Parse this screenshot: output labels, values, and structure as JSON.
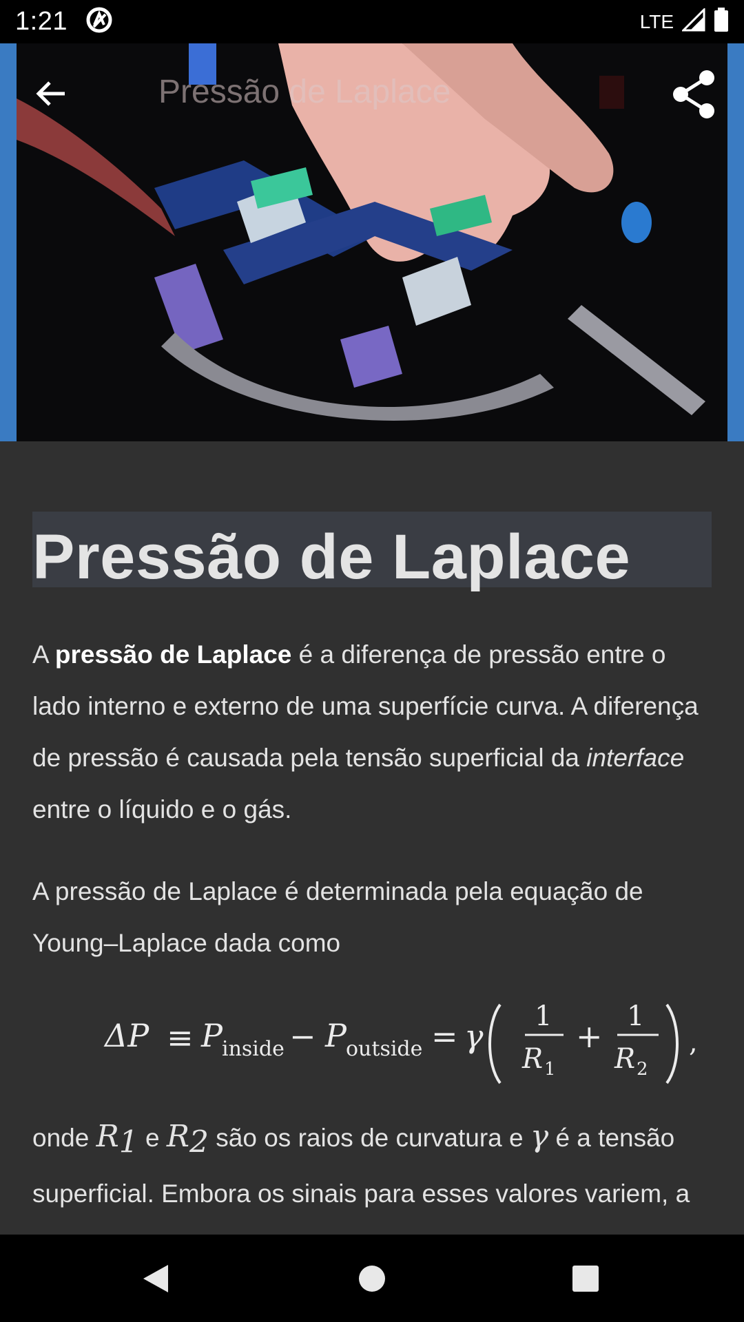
{
  "status_bar": {
    "time": "1:21",
    "network": "LTE",
    "icons": [
      "notification-a-icon",
      "signal-icon",
      "battery-icon"
    ]
  },
  "toolbar": {
    "title": "Pressão de Laplace",
    "back_icon": "arrow-back-icon",
    "share_icon": "share-icon"
  },
  "article": {
    "title": "Pressão de Laplace",
    "p1": {
      "a": "A ",
      "bold": "pressão de Laplace",
      "b": " é a diferença de pressão entre o lado interno e externo de uma superfície curva. A diferença de pressão é causada pela tensão superficial da ",
      "italic": "interface",
      "c": " entre o líquido e o gás."
    },
    "p2": "A pressão de Laplace é determinada pela equação de Young–Laplace dada como",
    "formula": {
      "delta_p": "ΔP",
      "equiv": "≡",
      "p": "P",
      "inside": "inside",
      "minus": "−",
      "outside": "outside",
      "equals": "=",
      "gamma": "γ",
      "one": "1",
      "r": "R",
      "sub1": "1",
      "sub2": "2",
      "plus": "+",
      "comma": ","
    },
    "p3": {
      "a": "onde ",
      "r1": "R",
      "r1_sub": "1",
      "b": " e ",
      "r2": "R",
      "r2_sub": "2",
      "c": " são os raios de curvatura e ",
      "gamma": "γ",
      "d": " é a tensão superficial. Embora os sinais para esses valores variem, a convenção de sinais normalmente dita que a curvatura"
    }
  },
  "nav_bar": {
    "back": "nav-back-icon",
    "home": "nav-home-icon",
    "recents": "nav-recents-icon"
  }
}
